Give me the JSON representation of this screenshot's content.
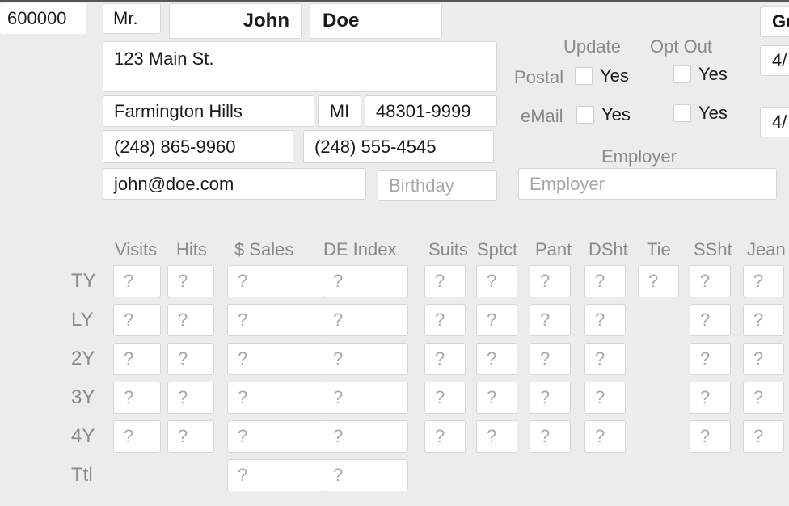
{
  "customer": {
    "id": "600000",
    "salutation": "Mr.",
    "first_name": "John",
    "last_name": "Doe",
    "address": "123 Main St.",
    "city": "Farmington Hills",
    "state": "MI",
    "zip": "48301-9999",
    "phone1": "(248) 865-9960",
    "phone2": "(248) 555-4545",
    "email": "john@doe.com",
    "birthday_placeholder": "Birthday",
    "employer_label": "Employer",
    "employer_placeholder": "Employer"
  },
  "preferences": {
    "update_label": "Update",
    "optout_label": "Opt Out",
    "postal_label": "Postal",
    "email_label": "eMail",
    "yes_label": "Yes"
  },
  "right_edge": {
    "field1": "Gu",
    "field2": "4/",
    "field3": "4/"
  },
  "stats": {
    "columns": [
      "Visits",
      "Hits",
      "$ Sales",
      "DE Index",
      "Suits",
      "Sptct",
      "Pant",
      "DSht",
      "Tie",
      "SSht",
      "Jean"
    ],
    "rows": [
      "TY",
      "LY",
      "2Y",
      "3Y",
      "4Y",
      "Ttl"
    ],
    "placeholder": "?"
  }
}
